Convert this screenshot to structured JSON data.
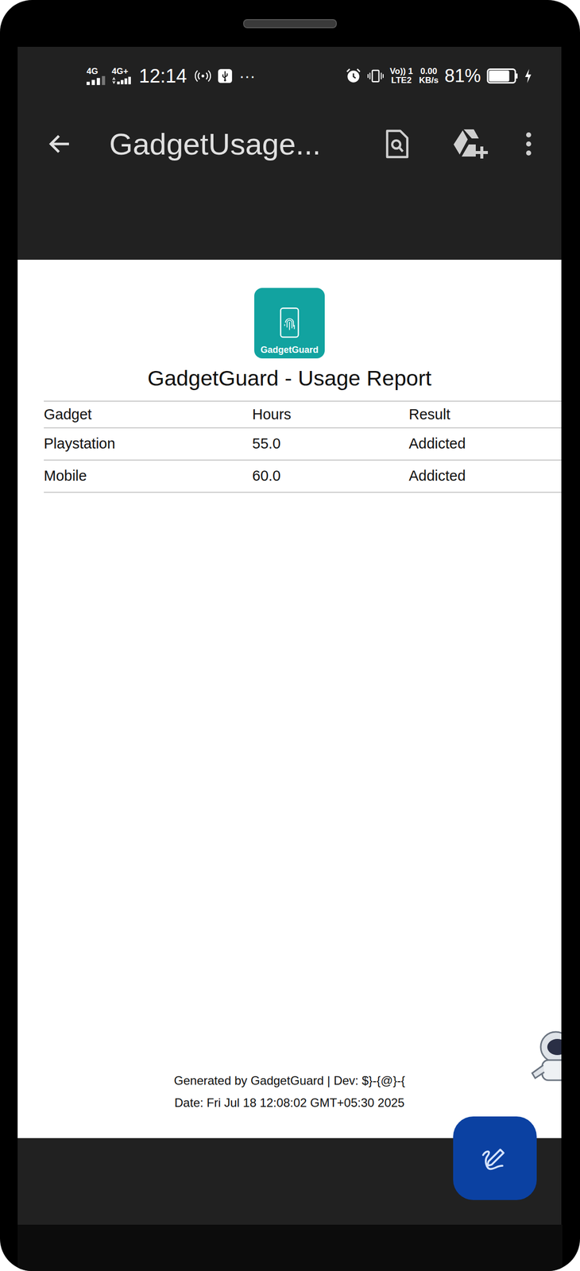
{
  "status_bar": {
    "network1": "4G",
    "network2": "4G+",
    "time": "12:14",
    "more": "···",
    "volte_top": "Vo)) 1",
    "volte_bottom": "LTE2",
    "speed_value": "0.00",
    "speed_unit": "KB/s",
    "battery_percent": "81%",
    "battery": {
      "level": 0.81,
      "charging": true
    }
  },
  "app_bar": {
    "title": "GadgetUsage..."
  },
  "document": {
    "logo_label": "GadgetGuard",
    "title": "GadgetGuard - Usage Report",
    "table": {
      "columns": [
        "Gadget",
        "Hours",
        "Result"
      ],
      "rows": [
        [
          "Playstation",
          "55.0",
          "Addicted"
        ],
        [
          "Mobile",
          "60.0",
          "Addicted"
        ]
      ]
    },
    "footer": {
      "line1": "Generated by GadgetGuard | Dev: $}-{@}-{",
      "line2": "Date: Fri Jul 18 12:08:02 GMT+05:30 2025"
    }
  }
}
